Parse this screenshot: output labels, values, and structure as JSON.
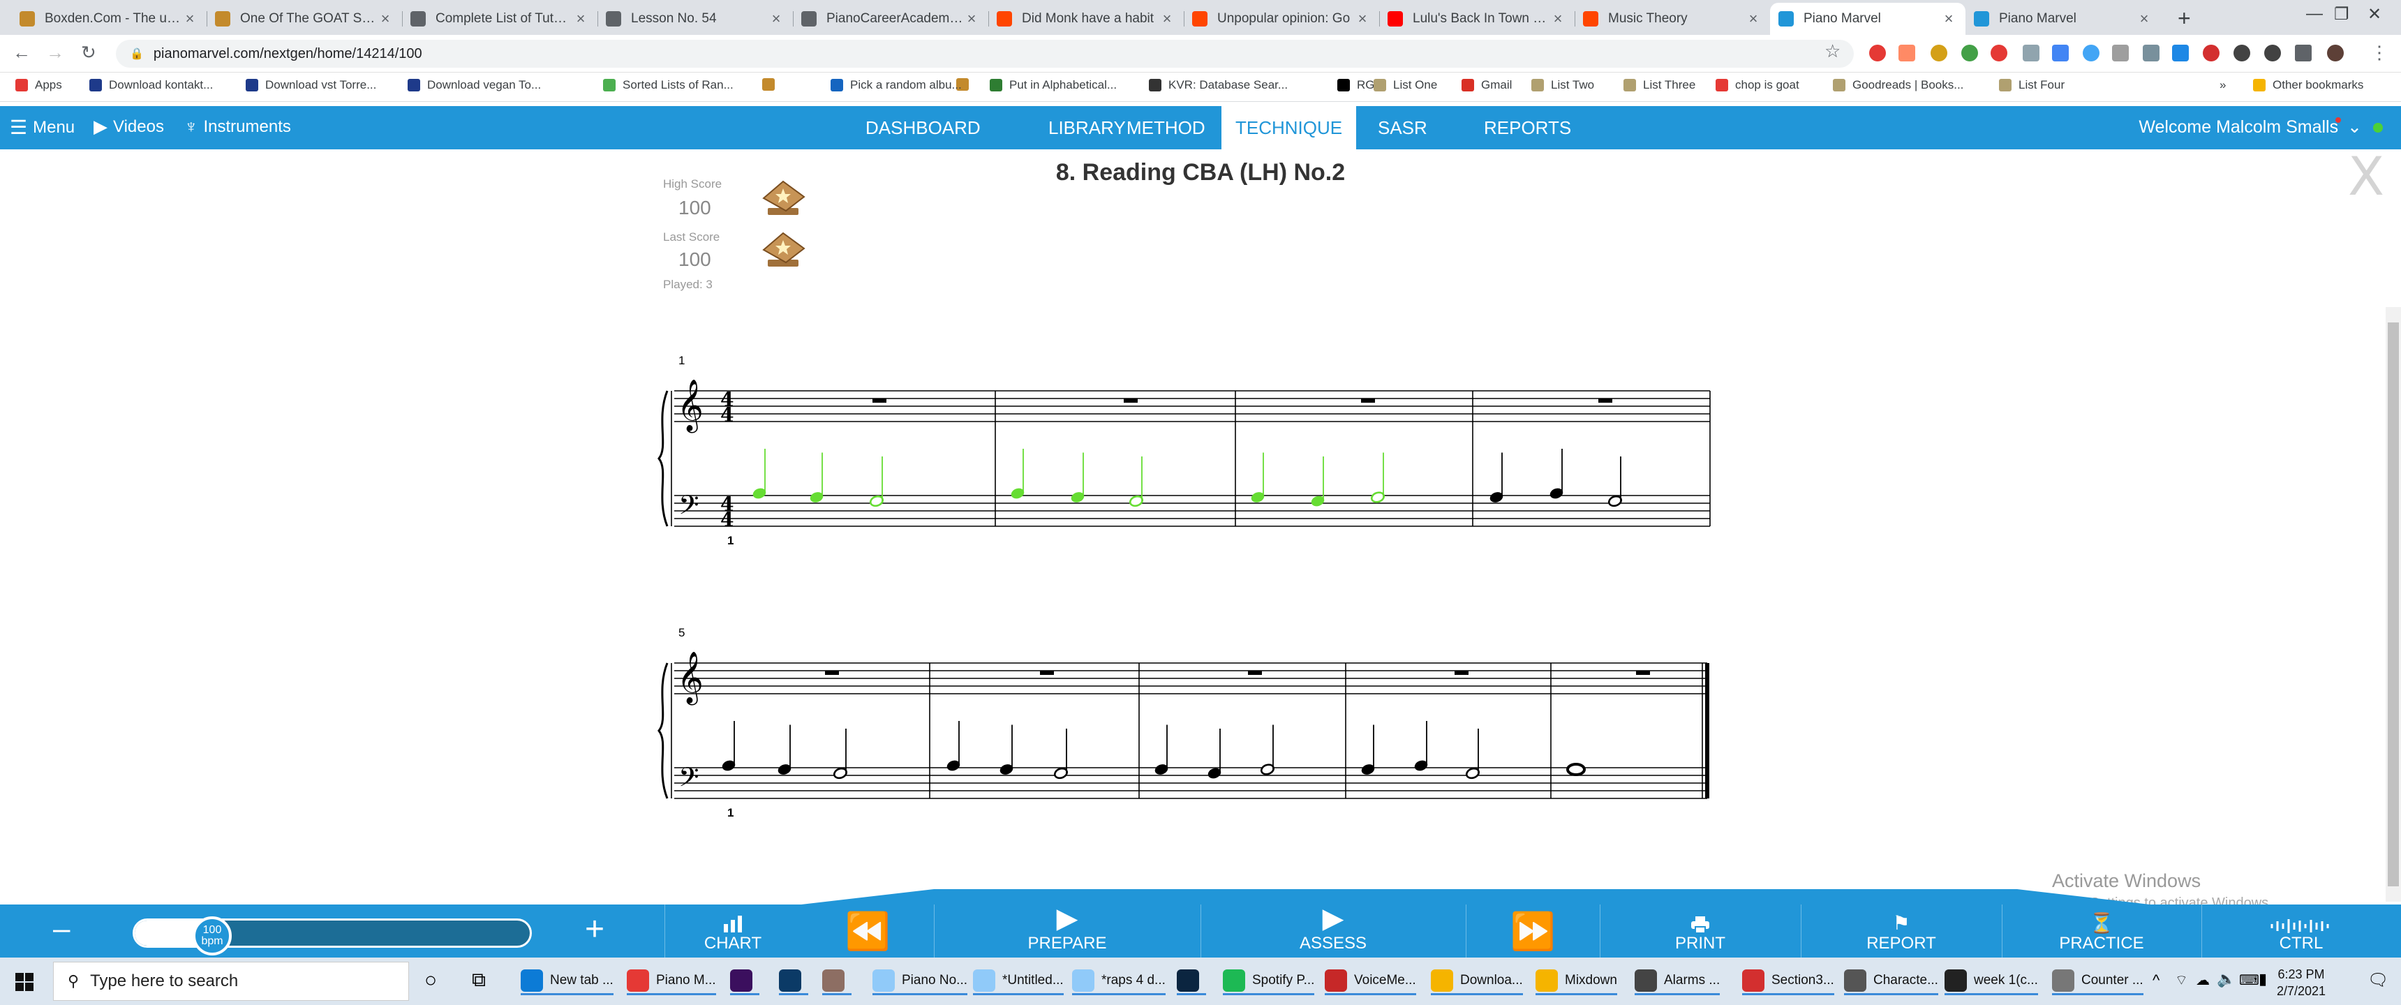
{
  "browser": {
    "tabs": [
      {
        "title": "Boxden.Com - The urban",
        "color": "#c38a2c"
      },
      {
        "title": "One Of The GOAT Songs",
        "color": "#c38a2c"
      },
      {
        "title": "Complete List of Tutorials",
        "color": "#5f6368"
      },
      {
        "title": "Lesson No. 54",
        "color": "#5f6368"
      },
      {
        "title": "PianoCareerAcademy.com",
        "color": "#5f6368"
      },
      {
        "title": "Did Monk have a habit",
        "color": "#ff4500"
      },
      {
        "title": "Unpopular opinion: Go",
        "color": "#ff4500"
      },
      {
        "title": "Lulu's Back In Town - Th",
        "color": "#ff0000"
      },
      {
        "title": "Music Theory",
        "color": "#ff4500"
      },
      {
        "title": "Piano Marvel",
        "color": "#2196d8"
      },
      {
        "title": "Piano Marvel",
        "color": "#2196d8"
      }
    ],
    "new_tab": "+",
    "url": "pianomarvel.com/nextgen/home/14214/100",
    "bookmarks": [
      {
        "label": "Apps",
        "color": "#e53935"
      },
      {
        "label": "Download kontakt...",
        "color": "#1e3a8a"
      },
      {
        "label": "Download vst Torre...",
        "color": "#1e3a8a"
      },
      {
        "label": "Download vegan To...",
        "color": "#1e3a8a"
      },
      {
        "label": "",
        "color": "#c38a2c"
      },
      {
        "label": "Sorted Lists of Ran...",
        "color": "#4caf50"
      },
      {
        "label": "",
        "color": "#c38a2c"
      },
      {
        "label": "Pick a random albu...",
        "color": "#1565c0"
      },
      {
        "label": "Put in Alphabetical...",
        "color": "#2e7d32"
      },
      {
        "label": "KVR: Database Sear...",
        "color": "#333333"
      },
      {
        "label": "RG",
        "color": "#000000"
      },
      {
        "label": "List One",
        "color": "#b0a070"
      },
      {
        "label": "Gmail",
        "color": "#d93025"
      },
      {
        "label": "List Two",
        "color": "#b0a070"
      },
      {
        "label": "List Three",
        "color": "#b0a070"
      },
      {
        "label": "chop is goat",
        "color": "#e53935"
      },
      {
        "label": "Goodreads | Books...",
        "color": "#b0a070"
      },
      {
        "label": "List Four",
        "color": "#b0a070"
      }
    ],
    "other_bookmarks": "Other bookmarks",
    "overflow": "»"
  },
  "app": {
    "menu": "Menu",
    "videos": "Videos",
    "instruments": "Instruments",
    "tabs": [
      "DASHBOARD",
      "LIBRARY",
      "METHOD",
      "TECHNIQUE",
      "SASR",
      "REPORTS"
    ],
    "active_tab": "TECHNIQUE",
    "welcome": "Welcome Malcolm Smalls",
    "close": "X"
  },
  "scores": {
    "high_label": "High Score",
    "high_value": "100",
    "last_label": "Last Score",
    "last_value": "100",
    "played": "Played: 3"
  },
  "song_title": "8. Reading CBA (LH) No.2",
  "sheet": {
    "system1_number": "1",
    "system2_number": "5",
    "fingering1": "1",
    "fingering2": "1",
    "time_sig_top": "4",
    "time_sig_bottom": "4",
    "note_colors": {
      "played": "#66dd33",
      "unplayed": "#000000"
    }
  },
  "bottom_bar": {
    "tempo_value": "100",
    "tempo_unit": "bpm",
    "tempo_fraction": 0.2,
    "minus": "–",
    "plus": "+",
    "chart": "CHART",
    "prepare": "PREPARE",
    "assess": "ASSESS",
    "print": "PRINT",
    "report": "REPORT",
    "practice": "PRACTICE",
    "ctrl": "CTRL"
  },
  "watermark": {
    "title": "Activate Windows",
    "subtitle": "Go to Settings to activate Windows."
  },
  "taskbar": {
    "search_placeholder": "Type here to search",
    "apps": [
      {
        "label": "New tab ...",
        "color": "#0c7bd6"
      },
      {
        "label": "Piano M...",
        "color": "#e53935"
      },
      {
        "label": "",
        "color": "#3b0f5e"
      },
      {
        "label": "",
        "color": "#0b3a66"
      },
      {
        "label": "",
        "color": "#8d6e63"
      },
      {
        "label": "Piano No...",
        "color": "#90caf9"
      },
      {
        "label": "*Untitled...",
        "color": "#90caf9"
      },
      {
        "label": "*raps 4 d...",
        "color": "#90caf9"
      },
      {
        "label": "",
        "color": "#0b2540"
      },
      {
        "label": "Spotify P...",
        "color": "#1db954"
      },
      {
        "label": "VoiceMe...",
        "color": "#c62828"
      },
      {
        "label": "Downloa...",
        "color": "#f5b400"
      },
      {
        "label": "Mixdown",
        "color": "#f5b400"
      },
      {
        "label": "Alarms ...",
        "color": "#444444"
      },
      {
        "label": "Section3...",
        "color": "#d32f2f"
      },
      {
        "label": "Characte...",
        "color": "#555555"
      },
      {
        "label": "week 1(c...",
        "color": "#222222"
      },
      {
        "label": "Counter ...",
        "color": "#777777"
      }
    ],
    "time": "6:23 PM",
    "date": "2/7/2021"
  }
}
